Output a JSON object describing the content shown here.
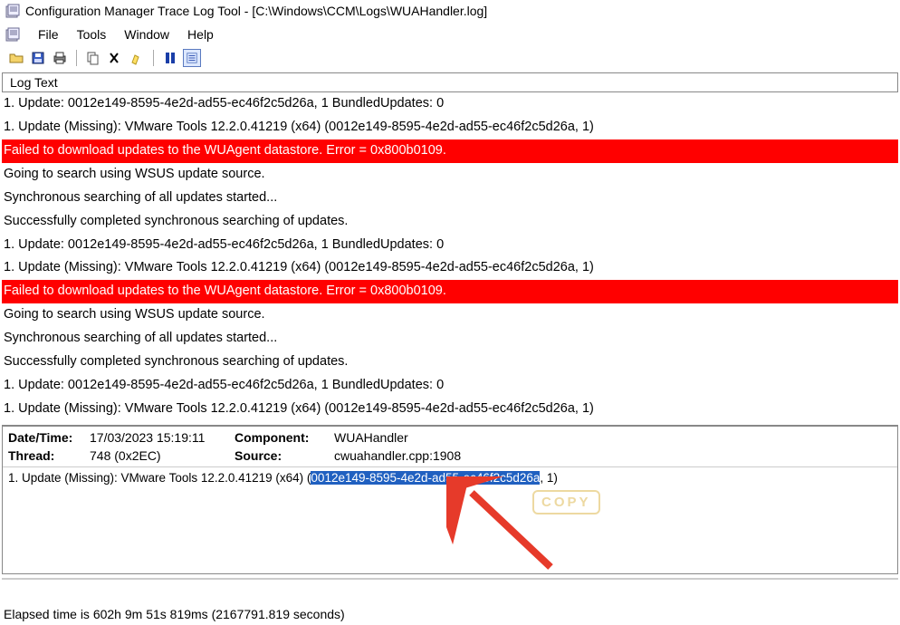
{
  "window": {
    "title": "Configuration Manager Trace Log Tool - [C:\\Windows\\CCM\\Logs\\WUAHandler.log]"
  },
  "menu": {
    "file": "File",
    "tools": "Tools",
    "window": "Window",
    "help": "Help"
  },
  "column_header": "Log Text",
  "log_lines": [
    {
      "text": "1. Update: 0012e149-8595-4e2d-ad55-ec46f2c5d26a, 1   BundledUpdates: 0",
      "error": false
    },
    {
      "text": "1. Update (Missing): VMware Tools 12.2.0.41219 (x64) (0012e149-8595-4e2d-ad55-ec46f2c5d26a, 1)",
      "error": false
    },
    {
      "text": "Failed to download updates to the WUAgent datastore. Error = 0x800b0109.",
      "error": true
    },
    {
      "text": "Going to search using WSUS update source.",
      "error": false
    },
    {
      "text": "Synchronous searching of all updates started...",
      "error": false
    },
    {
      "text": "Successfully completed synchronous searching of updates.",
      "error": false
    },
    {
      "text": "1. Update: 0012e149-8595-4e2d-ad55-ec46f2c5d26a, 1   BundledUpdates: 0",
      "error": false
    },
    {
      "text": "1. Update (Missing): VMware Tools 12.2.0.41219 (x64) (0012e149-8595-4e2d-ad55-ec46f2c5d26a, 1)",
      "error": false
    },
    {
      "text": "Failed to download updates to the WUAgent datastore. Error = 0x800b0109.",
      "error": true
    },
    {
      "text": "Going to search using WSUS update source.",
      "error": false
    },
    {
      "text": "Synchronous searching of all updates started...",
      "error": false
    },
    {
      "text": "Successfully completed synchronous searching of updates.",
      "error": false
    },
    {
      "text": "1. Update: 0012e149-8595-4e2d-ad55-ec46f2c5d26a, 1   BundledUpdates: 0",
      "error": false
    },
    {
      "text": "1. Update (Missing): VMware Tools 12.2.0.41219 (x64) (0012e149-8595-4e2d-ad55-ec46f2c5d26a, 1)",
      "error": false
    }
  ],
  "details": {
    "datetime_label": "Date/Time:",
    "datetime_value": "17/03/2023 15:19:11",
    "component_label": "Component:",
    "component_value": "WUAHandler",
    "thread_label": "Thread:",
    "thread_value": "748 (0x2EC)",
    "source_label": "Source:",
    "source_value": "cwuahandler.cpp:1908",
    "body_prefix": "1. Update (Missing): VMware Tools 12.2.0.41219 (x64) (",
    "body_highlight": "0012e149-8595-4e2d-ad55-ec46f2c5d26a",
    "body_suffix": ", 1)"
  },
  "watermark": "COPY",
  "status": "Elapsed time is 602h 9m 51s 819ms (2167791.819 seconds)"
}
